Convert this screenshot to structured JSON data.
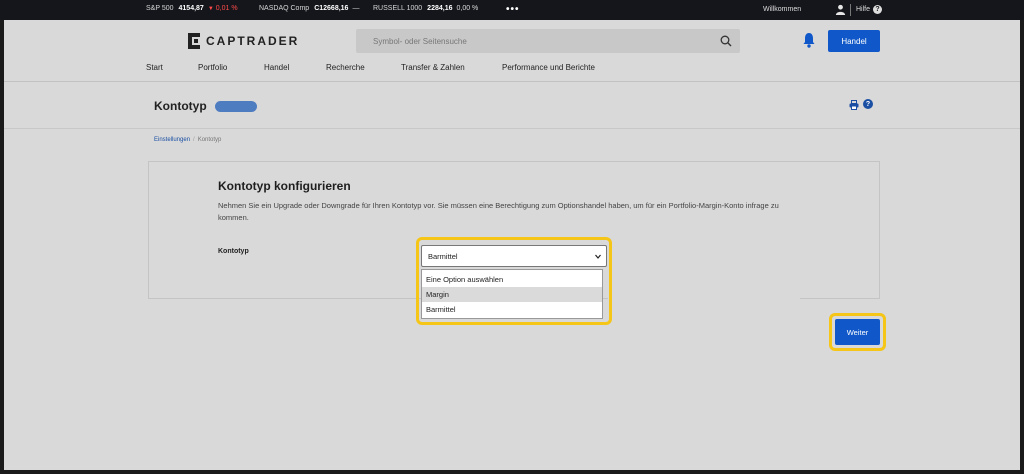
{
  "ticker": {
    "items": [
      {
        "label": "S&P 500",
        "value": "4154,87",
        "change": "0,01 %",
        "trend": "down"
      },
      {
        "label": "NASDAQ Comp",
        "value": "C12668,16",
        "change": "—",
        "trend": "flat"
      },
      {
        "label": "RUSSELL 1000",
        "value": "2284,16",
        "change": "0,00 %",
        "trend": "flat"
      }
    ],
    "more": "•••",
    "welcome": "Willkommen",
    "help": "Hilfe"
  },
  "header": {
    "logo_text": "CAPTRADER",
    "search_placeholder": "Symbol- oder Seitensuche",
    "trade_button": "Handel"
  },
  "nav": {
    "items": [
      "Start",
      "Portfolio",
      "Handel",
      "Recherche",
      "Transfer & Zahlen",
      "Performance und Berichte"
    ]
  },
  "page": {
    "title": "Kontotyp",
    "breadcrumb": [
      "Einstellungen",
      "Kontotyp"
    ]
  },
  "form": {
    "heading": "Kontotyp konfigurieren",
    "description": "Nehmen Sie ein Upgrade oder Downgrade für Ihren Kontotyp vor. Sie müssen eine Berechtigung zum Optionshandel haben, um für ein Portfolio-Margin-Konto infrage zu kommen.",
    "field_label": "Kontotyp",
    "selected_value": "Barmittel",
    "options": [
      "Eine Option auswählen",
      "Margin",
      "Barmittel"
    ],
    "highlighted_option": "Margin"
  },
  "actions": {
    "next_button": "Weiter"
  },
  "colors": {
    "accent": "#1058c9",
    "highlight": "#f5c518",
    "negative": "#ff4a4a"
  }
}
